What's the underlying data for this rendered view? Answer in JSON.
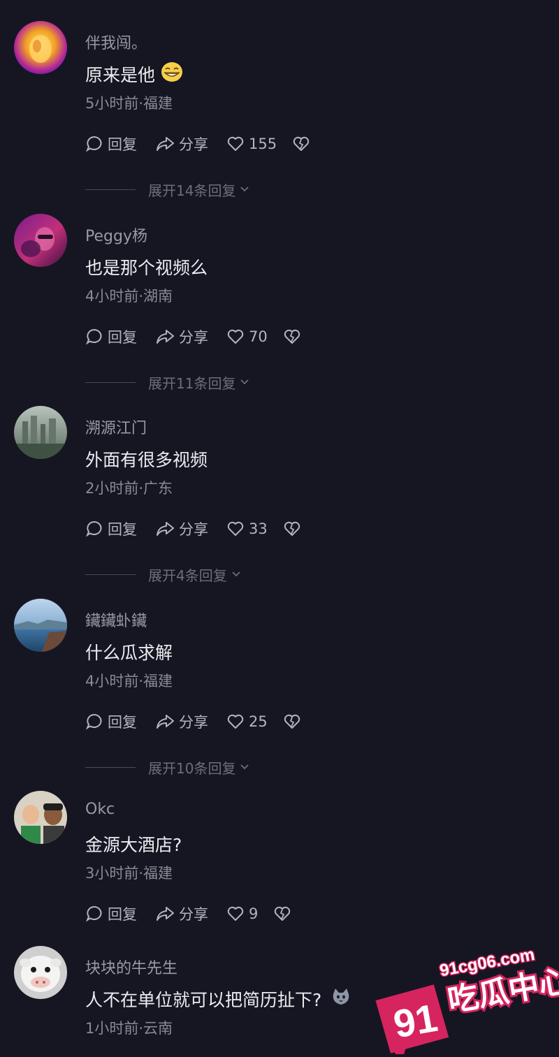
{
  "comments": [
    {
      "username": "伴我闯。",
      "text": "原来是他",
      "emoji": "grin-face-icon",
      "meta": "5小时前·福建",
      "reply_label": "回复",
      "share_label": "分享",
      "likes": "155",
      "expand": "展开14条回复"
    },
    {
      "username": "Peggy杨",
      "text": "也是那个视频么",
      "meta": "4小时前·湖南",
      "reply_label": "回复",
      "share_label": "分享",
      "likes": "70",
      "expand": "展开11条回复"
    },
    {
      "username": "溯源江门",
      "text": "外面有很多视频",
      "meta": "2小时前·广东",
      "reply_label": "回复",
      "share_label": "分享",
      "likes": "33",
      "expand": "展开4条回复"
    },
    {
      "username": "鑶鑶虲鑶",
      "text": "什么瓜求解",
      "meta": "4小时前·福建",
      "reply_label": "回复",
      "share_label": "分享",
      "likes": "25",
      "expand": "展开10条回复"
    },
    {
      "username": "Okc",
      "text": "金源大酒店?",
      "meta": "3小时前·福建",
      "reply_label": "回复",
      "share_label": "分享",
      "likes": "9"
    },
    {
      "username": "块块的牛先生",
      "text": "人不在单位就可以把简历扯下?",
      "emoji": "cat-face-icon",
      "meta": "1小时前·云南"
    }
  ],
  "watermark": {
    "number": "91",
    "site": "91cg06.com",
    "slogan": "吃瓜中心",
    "color": "#d6245f"
  }
}
